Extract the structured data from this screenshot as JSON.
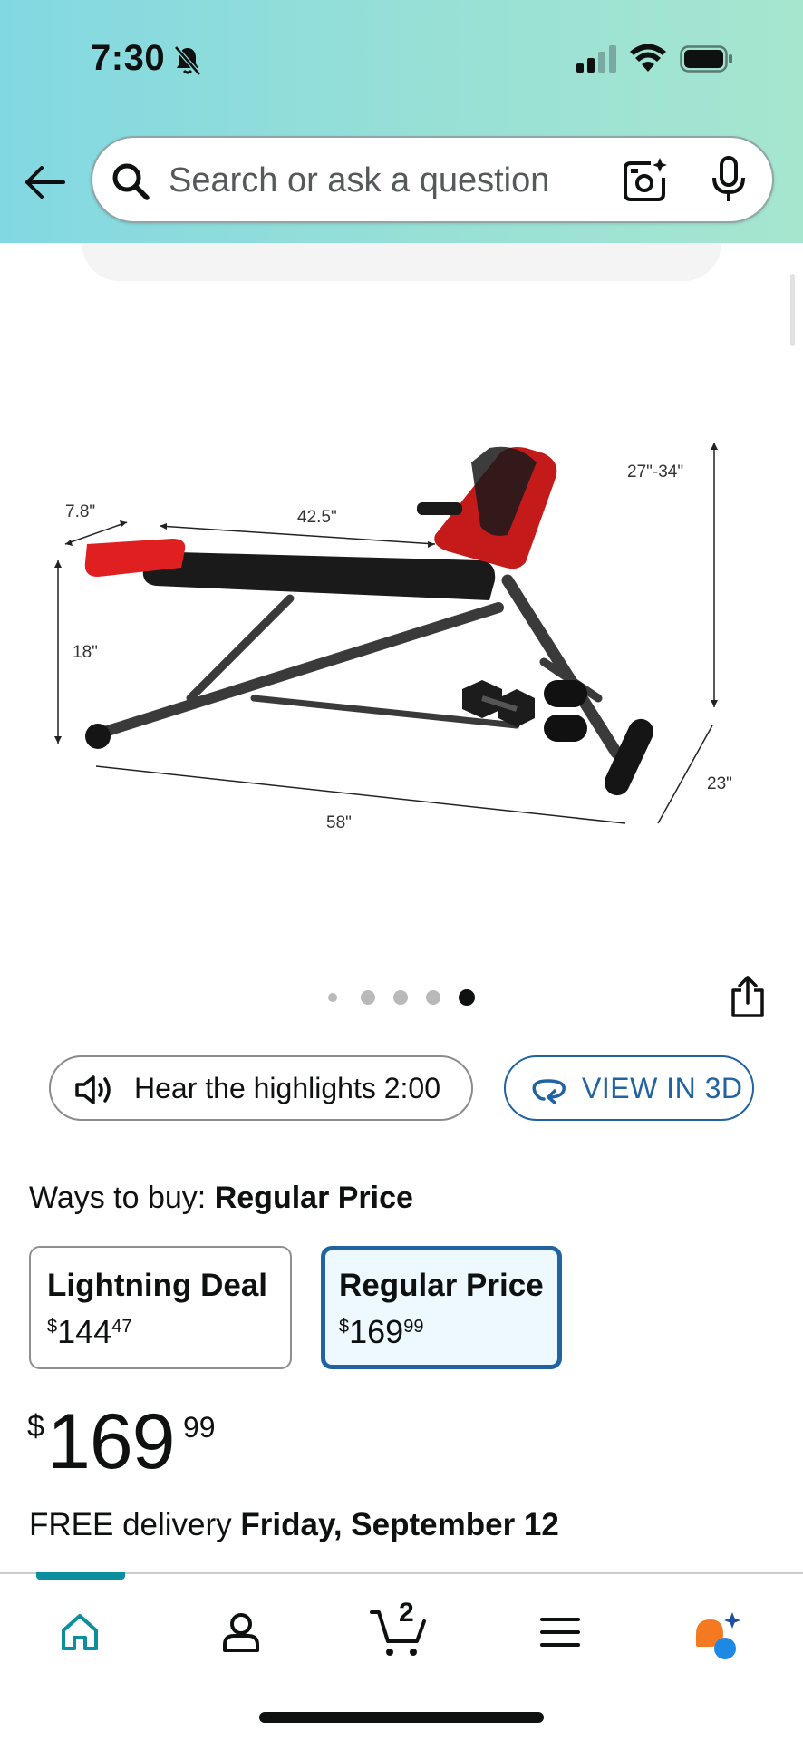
{
  "status_bar": {
    "time": "7:30"
  },
  "search": {
    "placeholder": "Search or ask a question"
  },
  "image_dimensions": {
    "depth_pad": "7.8\"",
    "seat_length": "42.5\"",
    "backrest_height": "27\"-34\"",
    "seat_height": "18\"",
    "total_length": "58\"",
    "width": "23\""
  },
  "carousel": {
    "total": 5,
    "active_index": 4
  },
  "buttons": {
    "hear_highlights": "Hear the highlights 2:00",
    "view_3d": "VIEW IN 3D"
  },
  "ways_to_buy": {
    "label": "Ways to buy:",
    "selected": "Regular Price",
    "options": [
      {
        "title": "Lightning Deal",
        "currency": "$",
        "whole": "144",
        "fraction": "47"
      },
      {
        "title": "Regular Price",
        "currency": "$",
        "whole": "169",
        "fraction": "99"
      }
    ]
  },
  "price": {
    "currency": "$",
    "whole": "169",
    "fraction": "99"
  },
  "delivery": {
    "prefix": "FREE delivery",
    "date": "Friday, September 12"
  },
  "tabbar": {
    "cart_count": "2",
    "active_tab": "home"
  },
  "colors": {
    "accent_blue": "#2162a1",
    "teal": "#0a8ea0",
    "header_gradient_start": "#82d8e2",
    "header_gradient_end": "#a6e6cf"
  }
}
